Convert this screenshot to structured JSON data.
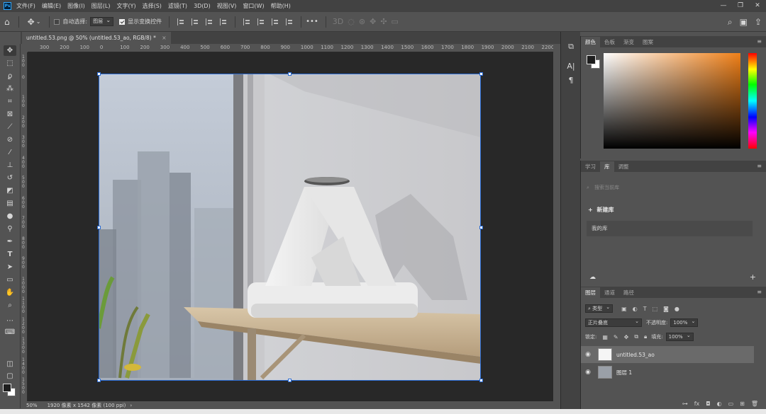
{
  "app": {
    "logo": "Ps"
  },
  "menu": [
    "文件(F)",
    "编辑(E)",
    "图像(I)",
    "图层(L)",
    "文字(Y)",
    "选择(S)",
    "滤镜(T)",
    "3D(D)",
    "视图(V)",
    "窗口(W)",
    "帮助(H)"
  ],
  "window_controls": {
    "minimize": "—",
    "restore": "❐",
    "close": "✕"
  },
  "options": {
    "auto_select_label": "自动选择:",
    "auto_select_value": "图层",
    "show_transform_label": "显示变换控件",
    "more": "•••"
  },
  "document_tab": {
    "title": "untitled.53.png @ 50% (untitled.53_ao, RGB/8) *",
    "close": "×"
  },
  "ruler_h": [
    "300",
    "200",
    "100",
    "0",
    "100",
    "200",
    "300",
    "400",
    "500",
    "600",
    "700",
    "800",
    "900",
    "1000",
    "1100",
    "1200",
    "1300",
    "1400",
    "1500",
    "1600",
    "1700",
    "1800",
    "1900",
    "2000",
    "2100",
    "2200"
  ],
  "ruler_v": [
    "1\n0\n0",
    "0",
    "1\n0\n0",
    "2\n0\n0",
    "3\n0\n0",
    "4\n0\n0",
    "5\n0\n0",
    "6\n0\n0",
    "7\n0\n0",
    "8\n0\n0",
    "9\n0\n0",
    "1\n0\n0\n0",
    "1\n1\n0\n0",
    "1\n2\n0\n0",
    "1\n3\n0\n0",
    "1\n4\n0\n0",
    "1\n5\n0\n0"
  ],
  "status": {
    "zoom": "50%",
    "info": "1920 像素 x 1542 像素 (100 ppi)",
    "arrow": "›"
  },
  "panels": {
    "color_tabs": [
      "颜色",
      "色板",
      "渐变",
      "图案"
    ],
    "library_tabs": [
      "学习",
      "库",
      "调整"
    ],
    "library_search_placeholder": "搜索当前库",
    "library_new": "新建库",
    "library_item": "我的库",
    "layers_tabs": [
      "图层",
      "通道",
      "路径"
    ],
    "kind_filter": "类型",
    "blend_mode": "正片叠底",
    "opacity_label": "不透明度:",
    "opacity_value": "100%",
    "lock_label": "锁定:",
    "fill_label": "填充:",
    "fill_value": "100%",
    "layers": [
      {
        "name": "untitled.53_ao",
        "selected": true
      },
      {
        "name": "图层 1",
        "selected": false
      }
    ],
    "footer_icons": [
      "link-icon",
      "fx-icon",
      "mask-icon",
      "adjustment-icon",
      "folder-icon",
      "new-layer-icon",
      "trash-icon"
    ]
  },
  "colors": {
    "accent": "#2a6bd3",
    "color_field_hue": "#f08018",
    "foreground": "#1e1e1e",
    "background": "#ffffff"
  }
}
